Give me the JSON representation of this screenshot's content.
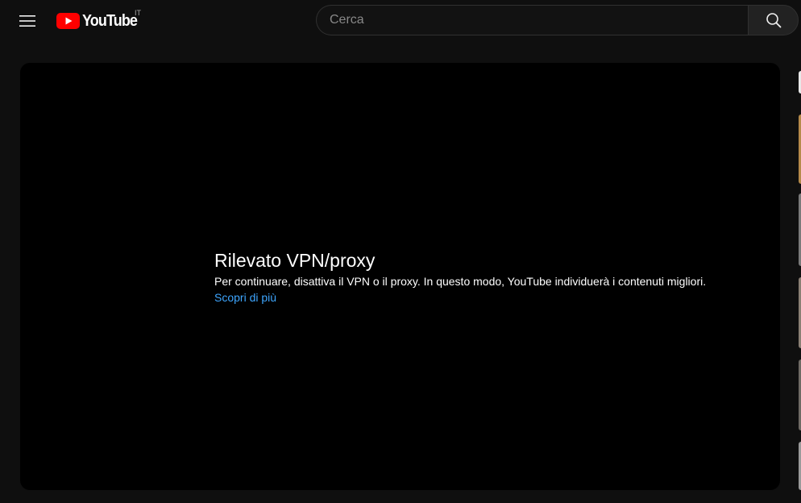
{
  "header": {
    "logo_text": "YouTube",
    "country_code": "IT",
    "search_placeholder": "Cerca"
  },
  "player": {
    "error_title": "Rilevato VPN/proxy",
    "error_message": "Per continuare, disattiva il VPN o il proxy. In questo modo, YouTube individuerà i contenuti migliori.",
    "learn_more_link": "Scopri di più"
  },
  "icons": {
    "menu": "menu-icon",
    "logo": "youtube-logo-icon",
    "search": "search-icon"
  },
  "colors": {
    "background": "#0f0f0f",
    "player_background": "#000000",
    "brand_red": "#ff0000",
    "link_blue": "#3ea6ff"
  }
}
